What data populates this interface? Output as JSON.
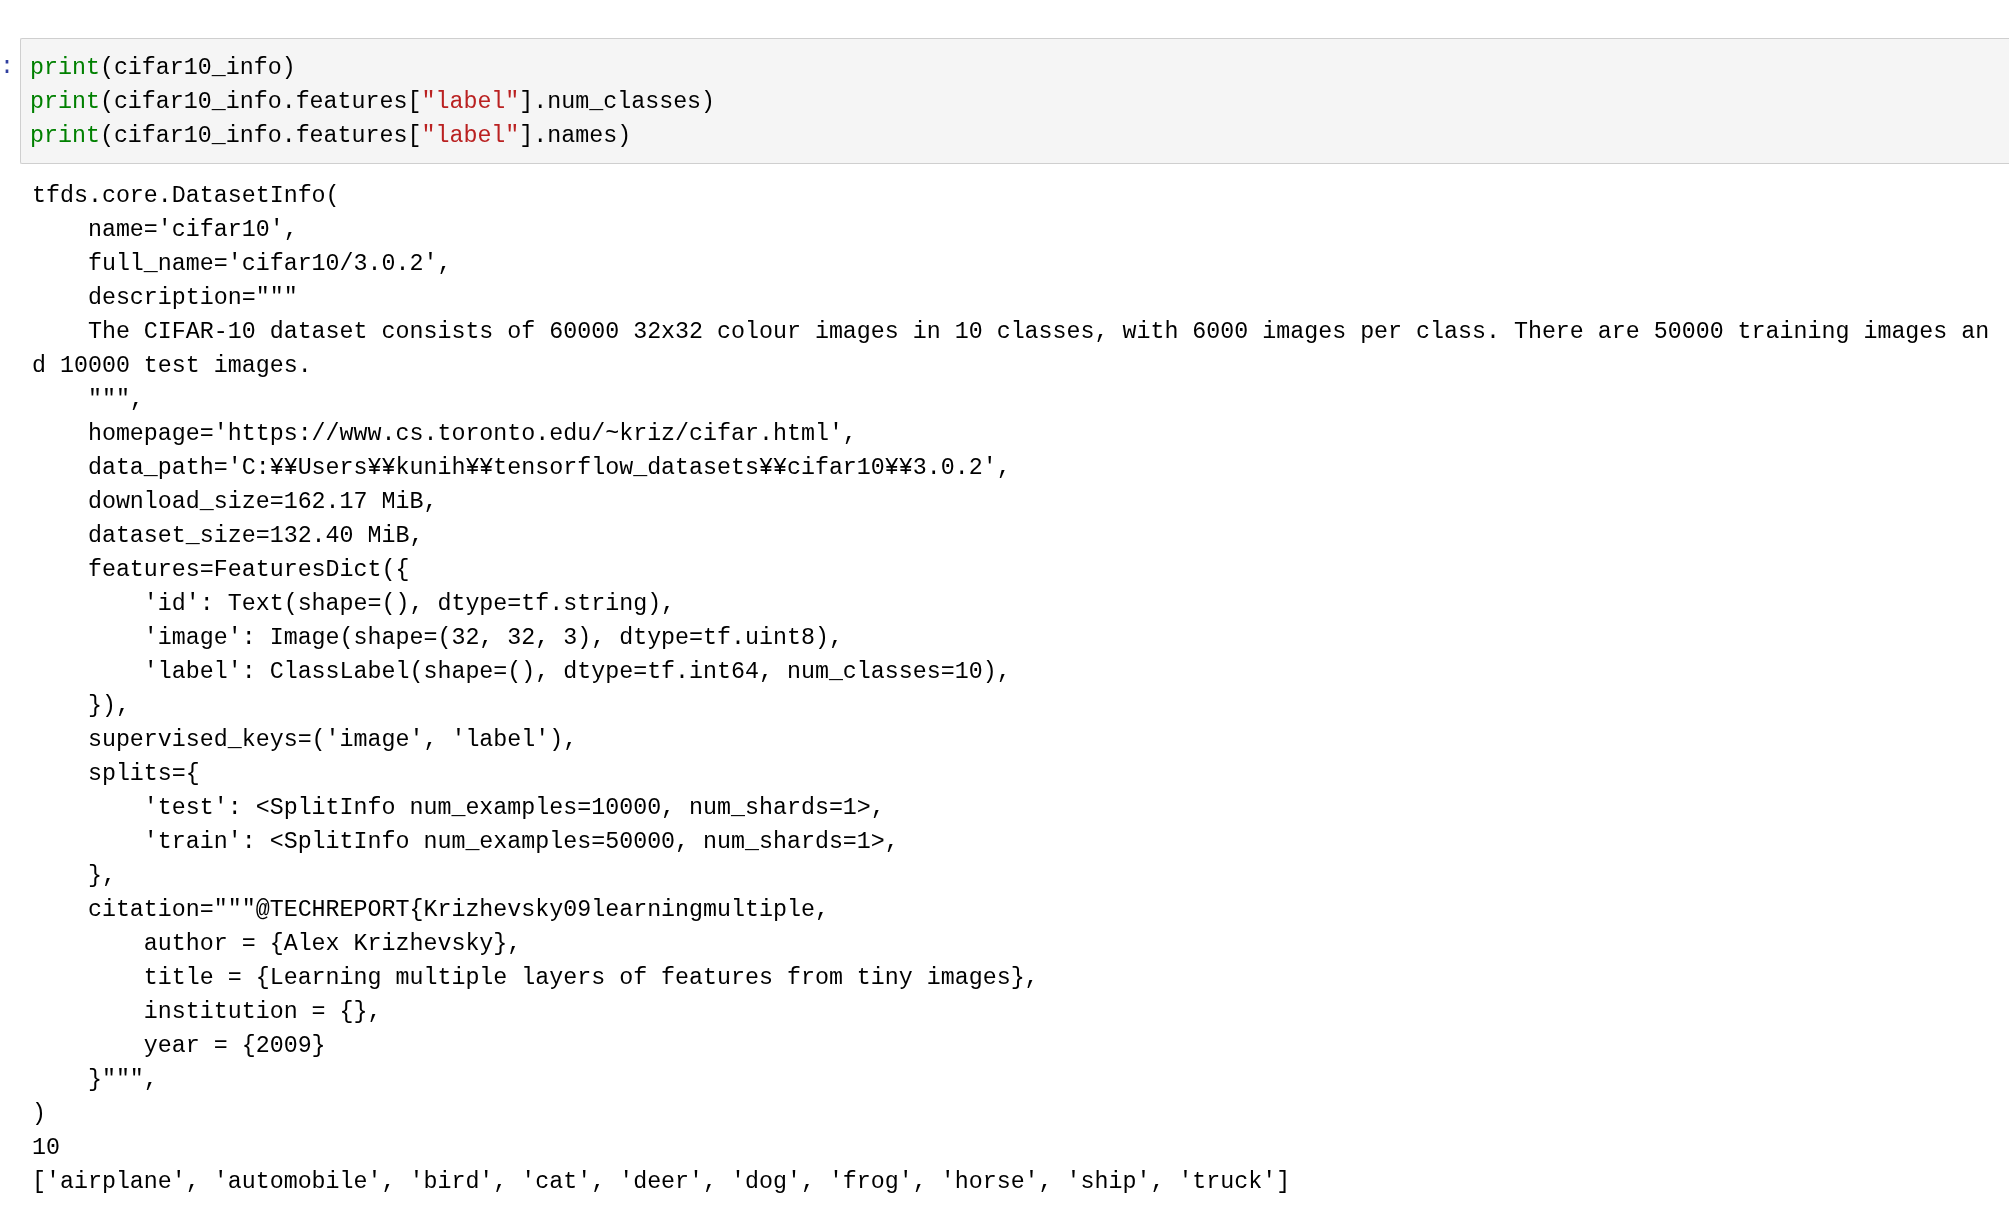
{
  "cell": {
    "prompt": ":",
    "code_lines": [
      [
        {
          "kind": "builtin",
          "text": "print"
        },
        {
          "kind": "plain",
          "text": "(cifar10_info)"
        }
      ],
      [
        {
          "kind": "builtin",
          "text": "print"
        },
        {
          "kind": "plain",
          "text": "(cifar10_info.features["
        },
        {
          "kind": "string",
          "text": "\"label\""
        },
        {
          "kind": "plain",
          "text": "].num_classes)"
        }
      ],
      [
        {
          "kind": "builtin",
          "text": "print"
        },
        {
          "kind": "plain",
          "text": "(cifar10_info.features["
        },
        {
          "kind": "string",
          "text": "\"label\""
        },
        {
          "kind": "plain",
          "text": "].names)"
        }
      ]
    ],
    "output_lines": [
      "tfds.core.DatasetInfo(",
      "    name='cifar10',",
      "    full_name='cifar10/3.0.2',",
      "    description=\"\"\"",
      "    The CIFAR-10 dataset consists of 60000 32x32 colour images in 10 classes, with 6000 images per class. There are 50000 training images an",
      "d 10000 test images.",
      "    \"\"\",",
      "    homepage='https://www.cs.toronto.edu/~kriz/cifar.html',",
      "    data_path='C:¥¥Users¥¥kunih¥¥tensorflow_datasets¥¥cifar10¥¥3.0.2',",
      "    download_size=162.17 MiB,",
      "    dataset_size=132.40 MiB,",
      "    features=FeaturesDict({",
      "        'id': Text(shape=(), dtype=tf.string),",
      "        'image': Image(shape=(32, 32, 3), dtype=tf.uint8),",
      "        'label': ClassLabel(shape=(), dtype=tf.int64, num_classes=10),",
      "    }),",
      "    supervised_keys=('image', 'label'),",
      "    splits={",
      "        'test': <SplitInfo num_examples=10000, num_shards=1>,",
      "        'train': <SplitInfo num_examples=50000, num_shards=1>,",
      "    },",
      "    citation=\"\"\"@TECHREPORT{Krizhevsky09learningmultiple,",
      "        author = {Alex Krizhevsky},",
      "        title = {Learning multiple layers of features from tiny images},",
      "        institution = {},",
      "        year = {2009}",
      "    }\"\"\",",
      ")",
      "10",
      "['airplane', 'automobile', 'bird', 'cat', 'deer', 'dog', 'frog', 'horse', 'ship', 'truck']"
    ]
  }
}
